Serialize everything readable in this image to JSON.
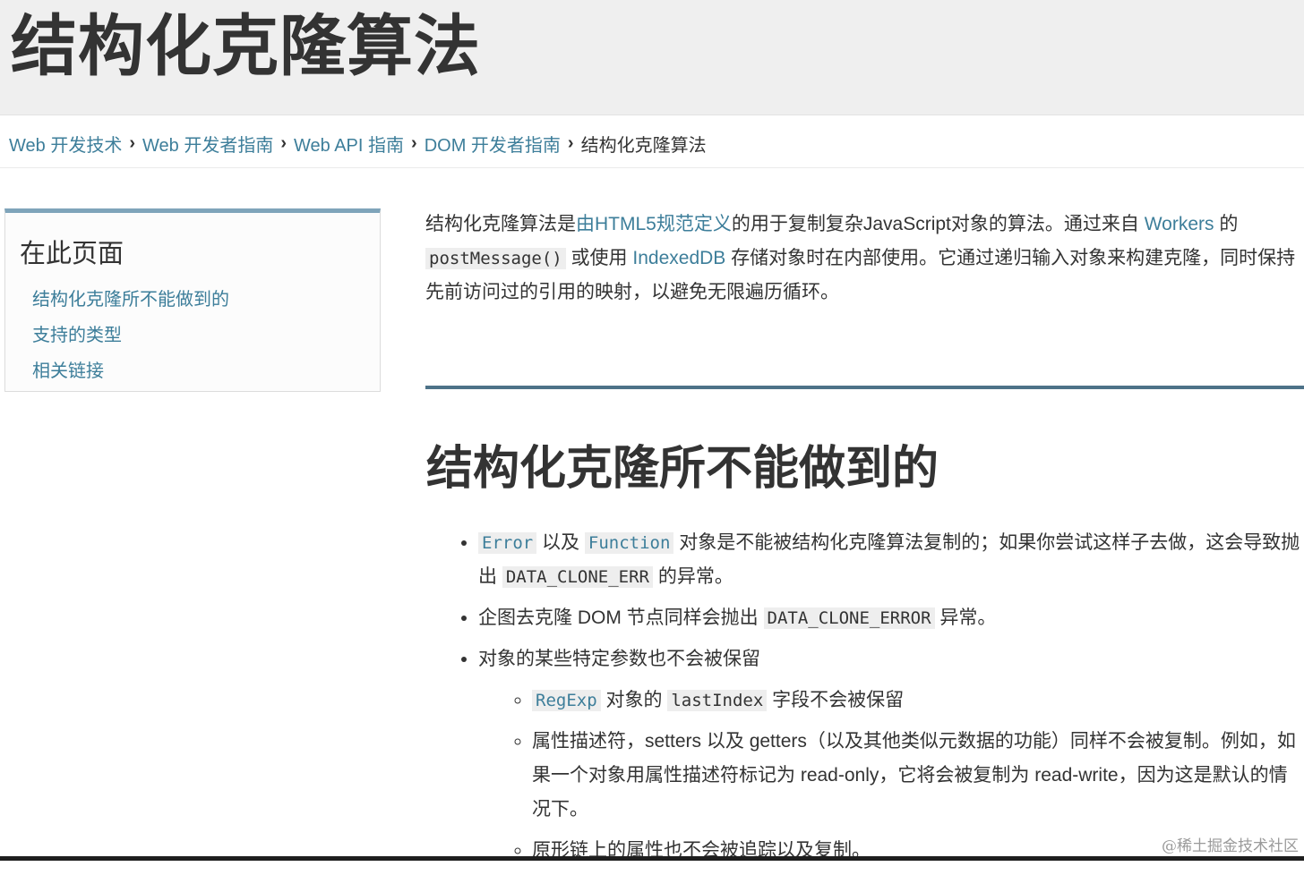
{
  "header": {
    "title": "结构化克隆算法"
  },
  "breadcrumb": {
    "items": [
      {
        "label": "Web 开发技术"
      },
      {
        "label": "Web 开发者指南"
      },
      {
        "label": "Web API 指南"
      },
      {
        "label": "DOM 开发者指南"
      }
    ],
    "separator": "›",
    "current": "结构化克隆算法"
  },
  "toc": {
    "title": "在此页面",
    "items": [
      {
        "label": "结构化克隆所不能做到的"
      },
      {
        "label": "支持的类型"
      },
      {
        "label": "相关链接"
      }
    ]
  },
  "intro": {
    "part1": "结构化克隆算法是",
    "link_spec": "由HTML5规范定义",
    "part2": "的用于复制复杂JavaScript对象的算法。通过来自 ",
    "link_workers": "Workers",
    "part3": " 的 ",
    "code_postmessage": "postMessage()",
    "part4": " 或使用 ",
    "link_indexeddb": "IndexedDB",
    "part5": " 存储对象时在内部使用。",
    "part6": "它通过递归输入对象来构建克隆，同时保持先前访问过的引用的映射，以避免无限遍历循环。"
  },
  "section": {
    "title": "结构化克隆所不能做到的",
    "bullet1": {
      "code_error": "Error",
      "text_a": " 以及 ",
      "code_function": "Function",
      "text_b": " 对象是不能被结构化克隆算法复制的；如果你尝试这样子去做，这会导致抛出 ",
      "code_err": "DATA_CLONE_ERR",
      "text_c": " 的异常。"
    },
    "bullet2": {
      "text_a": "企图去克隆 DOM 节点同样会抛出 ",
      "code_error": "DATA_CLONE_ERROR",
      "text_b": " 异常。"
    },
    "bullet3": {
      "text": "对象的某些特定参数也不会被保留",
      "sub1": {
        "code_regexp": "RegExp",
        "text_a": " 对象的 ",
        "code_lastindex": "lastIndex",
        "text_b": " 字段不会被保留"
      },
      "sub2": {
        "text": "属性描述符，setters 以及 getters（以及其他类似元数据的功能）同样不会被复制。例如，如果一个对象用属性描述符标记为 read-only，它将会被复制为 read-write，因为这是默认的情况下。"
      },
      "sub3": {
        "text": "原形链上的属性也不会被追踪以及复制。"
      }
    }
  },
  "watermark": "@稀土掘金技术社区"
}
